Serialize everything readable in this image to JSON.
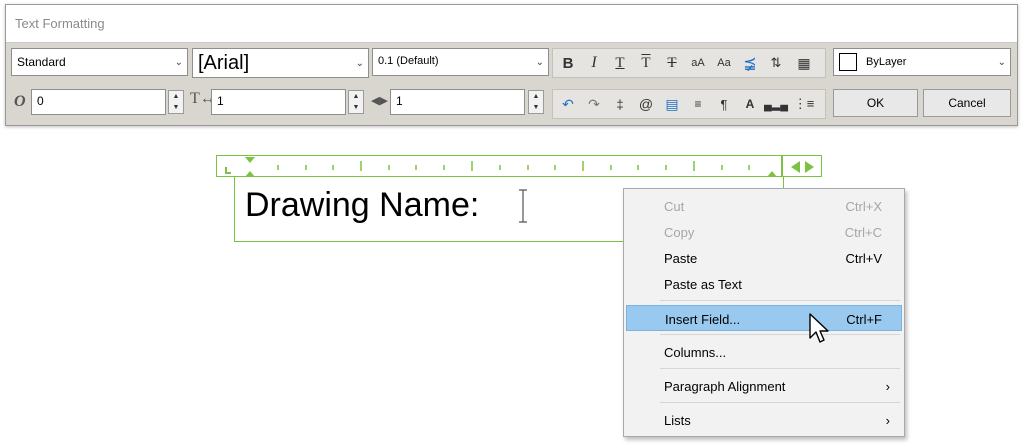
{
  "window": {
    "title": "Text Formatting"
  },
  "toolbar": {
    "style": "Standard",
    "font": "[Arial]",
    "height": "0.1 (Default)",
    "color": "ByLayer",
    "color_swatch": "#ffffff",
    "format_icons": [
      "bold-icon",
      "italic-icon",
      "underline-icon",
      "overline-icon",
      "strikethrough-icon",
      "uppercase-icon",
      "lowercase-icon",
      "stack-icon",
      "line-spacing-icon",
      "columns-icon"
    ],
    "obliquing_value": "0",
    "tracking_value": "1",
    "width_factor_value": "1",
    "insert_icons": [
      "undo-icon",
      "redo-icon",
      "symbol-icon",
      "insert-field-icon",
      "paragraph-icon",
      "left-align-icon",
      "justify-icon",
      "background-mask-icon",
      "distribute-icon",
      "numbering-icon"
    ],
    "ok_label": "OK",
    "cancel_label": "Cancel"
  },
  "editor": {
    "text": "Drawing Name:"
  },
  "context_menu": {
    "items": [
      {
        "label": "Cut",
        "shortcut": "Ctrl+X",
        "disabled": true
      },
      {
        "label": "Copy",
        "shortcut": "Ctrl+C",
        "disabled": true
      },
      {
        "label": "Paste",
        "shortcut": "Ctrl+V",
        "disabled": false
      },
      {
        "label": "Paste as Text",
        "shortcut": "",
        "disabled": false
      },
      {
        "label": "Insert Field...",
        "shortcut": "Ctrl+F",
        "highlighted": true
      },
      {
        "label": "Columns...",
        "shortcut": ""
      },
      {
        "label": "Paragraph Alignment",
        "shortcut": "",
        "submenu": true
      },
      {
        "label": "Lists",
        "shortcut": "",
        "submenu": true
      }
    ]
  },
  "colors": {
    "accent_green": "#7cc242",
    "menu_highlight": "#99c9ef",
    "icon_blue": "#1f6fc5"
  }
}
